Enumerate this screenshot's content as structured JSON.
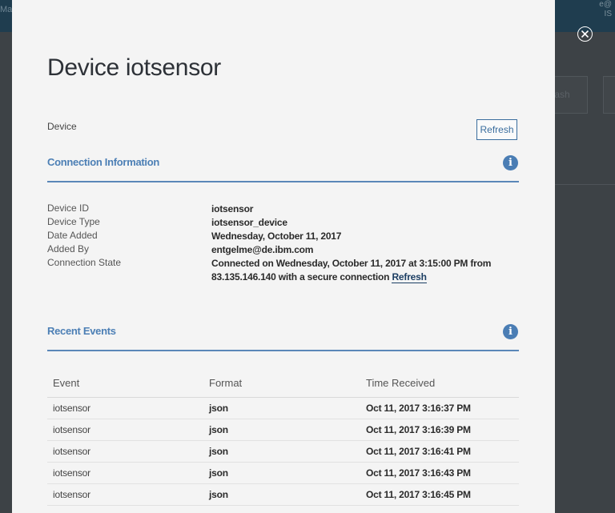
{
  "background": {
    "left_fragment": "Ma",
    "right_fragment_1": "e@",
    "right_fragment_2": "IS",
    "button_fragment": "ash"
  },
  "modal": {
    "title": "Device iotsensor",
    "subtitle": "Device",
    "refresh_label": "Refresh"
  },
  "connection": {
    "heading": "Connection Information",
    "info_icon": "info-icon",
    "rows": [
      {
        "label": "Device ID",
        "value": "iotsensor"
      },
      {
        "label": "Device Type",
        "value": "iotsensor_device"
      },
      {
        "label": "Date Added",
        "value": "Wednesday, October 11, 2017"
      },
      {
        "label": "Added By",
        "value": "entgelme@de.ibm.com"
      },
      {
        "label": "Connection State",
        "value": "Connected on Wednesday, October 11, 2017 at 3:15:00 PM from 83.135.146.140 with a secure connection",
        "link": "Refresh"
      }
    ]
  },
  "events": {
    "heading": "Recent Events",
    "columns": [
      "Event",
      "Format",
      "Time Received"
    ],
    "rows": [
      {
        "event": "iotsensor",
        "format": "json",
        "time": "Oct 11, 2017 3:16:37 PM"
      },
      {
        "event": "iotsensor",
        "format": "json",
        "time": "Oct 11, 2017 3:16:39 PM"
      },
      {
        "event": "iotsensor",
        "format": "json",
        "time": "Oct 11, 2017 3:16:41 PM"
      },
      {
        "event": "iotsensor",
        "format": "json",
        "time": "Oct 11, 2017 3:16:43 PM"
      },
      {
        "event": "iotsensor",
        "format": "json",
        "time": "Oct 11, 2017 3:16:45 PM"
      }
    ]
  },
  "colors": {
    "accent": "#4c7fb5",
    "modal_bg": "#f4f4f4",
    "overlay": "#3b3f44"
  }
}
